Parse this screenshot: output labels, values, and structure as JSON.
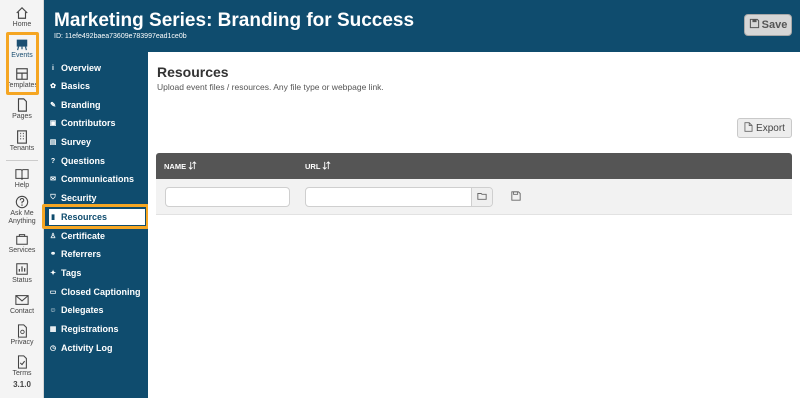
{
  "rail": {
    "items": [
      {
        "label": "Home",
        "icon": "home-icon"
      },
      {
        "label": "Events",
        "icon": "events-icon"
      },
      {
        "label": "Templates",
        "icon": "templates-icon"
      },
      {
        "label": "Pages",
        "icon": "pages-icon"
      },
      {
        "label": "Tenants",
        "icon": "tenants-icon"
      },
      {
        "label": "Help",
        "icon": "help-book-icon"
      },
      {
        "label": "Ask Me Anything",
        "icon": "question-icon"
      },
      {
        "label": "Services",
        "icon": "services-icon"
      },
      {
        "label": "Status",
        "icon": "status-icon"
      },
      {
        "label": "Contact",
        "icon": "contact-icon"
      },
      {
        "label": "Privacy",
        "icon": "privacy-icon"
      },
      {
        "label": "Terms",
        "icon": "terms-icon"
      }
    ],
    "version": "3.1.0"
  },
  "header": {
    "title": "Marketing Series: Branding for Success",
    "event_id": "ID: 11efe492baea73609e783997ead1ce0b",
    "save_label": "Save"
  },
  "nav": {
    "items": [
      {
        "label": "Overview",
        "icon": "info-icon"
      },
      {
        "label": "Basics",
        "icon": "palette-icon"
      },
      {
        "label": "Branding",
        "icon": "brush-icon"
      },
      {
        "label": "Contributors",
        "icon": "id-card-icon"
      },
      {
        "label": "Survey",
        "icon": "survey-icon"
      },
      {
        "label": "Questions",
        "icon": "question-mark-icon"
      },
      {
        "label": "Communications",
        "icon": "envelope-icon"
      },
      {
        "label": "Security",
        "icon": "shield-icon"
      },
      {
        "label": "Resources",
        "icon": "file-icon"
      },
      {
        "label": "Certificate",
        "icon": "award-icon"
      },
      {
        "label": "Referrers",
        "icon": "link-icon"
      },
      {
        "label": "Tags",
        "icon": "tag-icon"
      },
      {
        "label": "Closed Captioning",
        "icon": "cc-icon"
      },
      {
        "label": "Delegates",
        "icon": "people-icon"
      },
      {
        "label": "Registrations",
        "icon": "list-icon"
      },
      {
        "label": "Activity Log",
        "icon": "clock-icon"
      }
    ],
    "active": "Resources"
  },
  "main": {
    "title": "Resources",
    "subtitle": "Upload event files / resources. Any file type or webpage link.",
    "export_label": "Export",
    "columns": [
      {
        "label": "NAME",
        "sort_icon": "sort-icon"
      },
      {
        "label": "URL",
        "sort_icon": "sort-icon"
      }
    ],
    "row": {
      "name_value": "",
      "url_value": ""
    }
  },
  "colors": {
    "brand": "#0f4c6e",
    "highlight": "#f5a623",
    "table_header": "#555555"
  }
}
